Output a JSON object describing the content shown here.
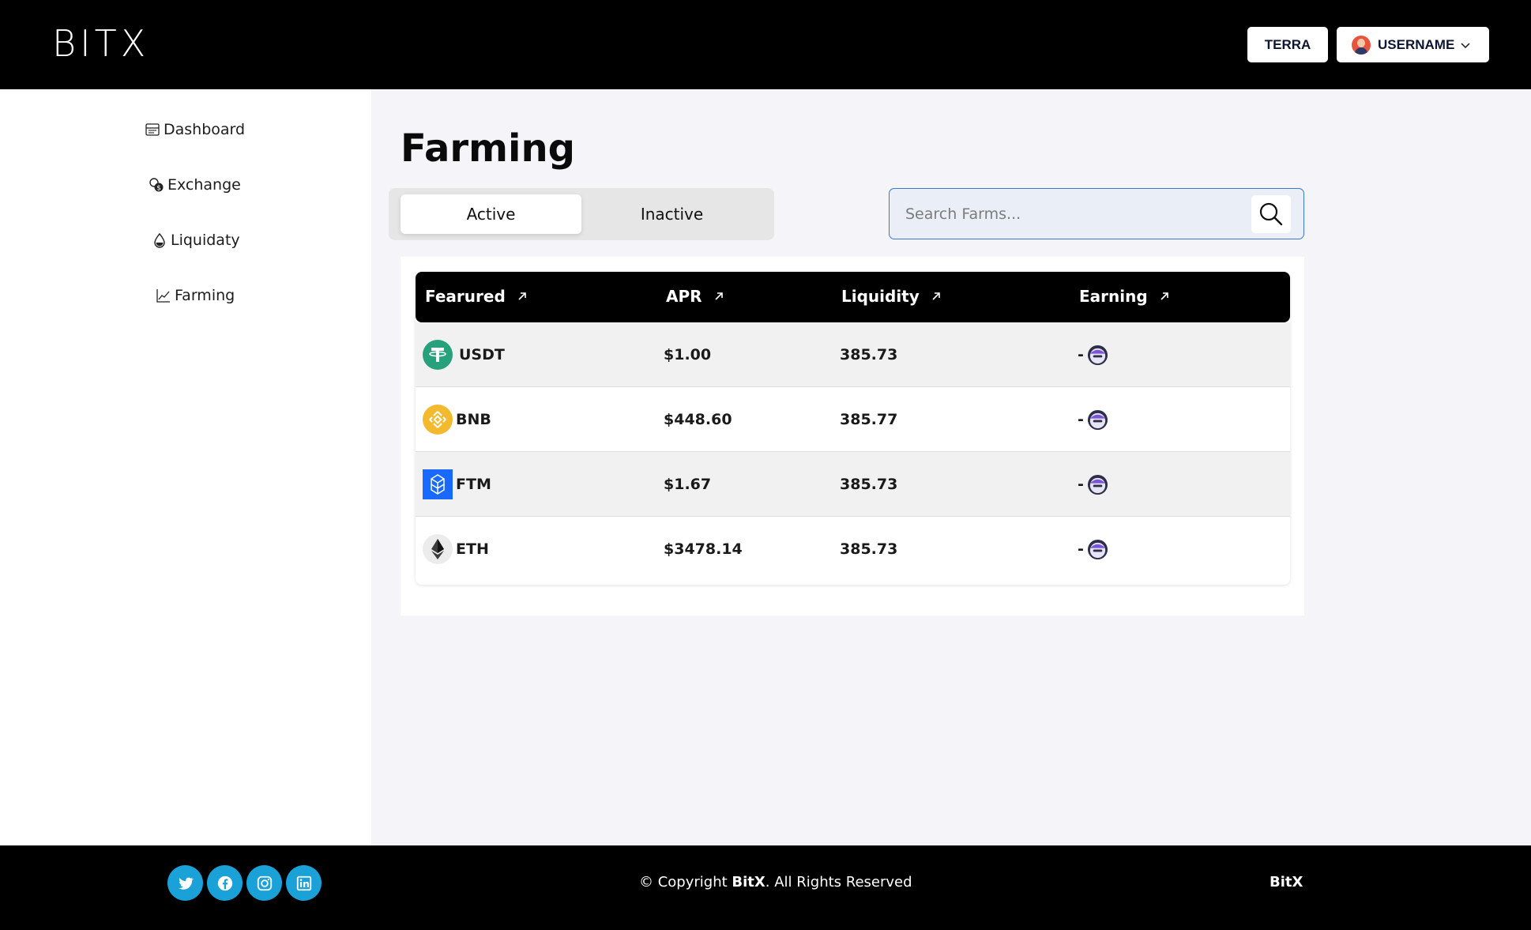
{
  "header": {
    "brand": "BITX",
    "network_button": "TERRA",
    "user_button": "USERNAME"
  },
  "sidebar": {
    "items": [
      {
        "label": "Dashboard",
        "icon": "dashboard-icon"
      },
      {
        "label": "Exchange",
        "icon": "exchange-icon"
      },
      {
        "label": "Liquidaty",
        "icon": "liquidity-drop-icon"
      },
      {
        "label": "Farming",
        "icon": "chart-line-icon"
      }
    ]
  },
  "main": {
    "title": "Farming",
    "tabs": [
      {
        "label": "Active",
        "selected": true
      },
      {
        "label": "Inactive",
        "selected": false
      }
    ],
    "search": {
      "placeholder": "Search Farms...",
      "value": ""
    }
  },
  "table": {
    "columns": [
      "Fearured",
      "APR",
      "Liquidity",
      "Earning"
    ],
    "rows": [
      {
        "token": "USDT",
        "apr": "$1.00",
        "liquidity": "385.73",
        "earning": "-",
        "icon": "tether-icon",
        "color": "#26a17b"
      },
      {
        "token": "BNB",
        "apr": "$448.60",
        "liquidity": "385.77",
        "earning": "-",
        "icon": "bnb-icon",
        "color": "#f3ba2f"
      },
      {
        "token": "FTM",
        "apr": "$1.67",
        "liquidity": "385.73",
        "earning": "-",
        "icon": "fantom-icon",
        "color": "#1969ff"
      },
      {
        "token": "ETH",
        "apr": "$3478.14",
        "liquidity": "385.73",
        "earning": "-",
        "icon": "ethereum-icon",
        "color": "#3c3c3d"
      }
    ]
  },
  "footer": {
    "copyright_prefix": "© Copyright ",
    "copyright_brand": "BitX",
    "copyright_suffix": ". All Rights Reserved",
    "brand": "BitX",
    "social": [
      "twitter-icon",
      "facebook-icon",
      "instagram-icon",
      "linkedin-icon"
    ],
    "social_color": "#1aa2d8"
  }
}
